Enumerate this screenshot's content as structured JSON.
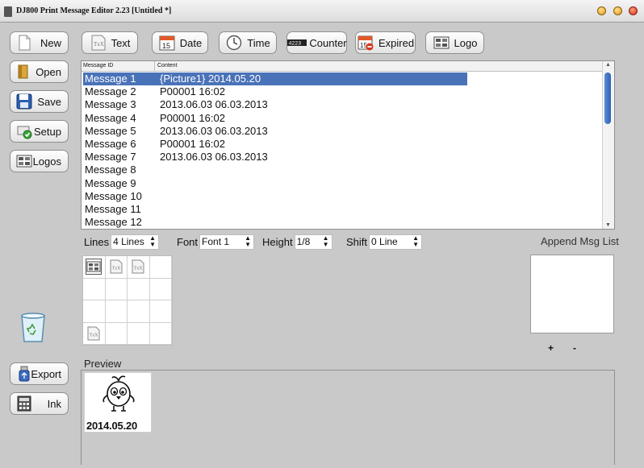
{
  "window": {
    "title": "DJ800 Print Message Editor 2.23 [Untitled *]"
  },
  "sidebar": [
    {
      "id": "new",
      "label": "New"
    },
    {
      "id": "open",
      "label": "Open"
    },
    {
      "id": "save",
      "label": "Save"
    },
    {
      "id": "setup",
      "label": "Setup"
    },
    {
      "id": "logos",
      "label": "Logos"
    }
  ],
  "sidebar_bottom": [
    {
      "id": "export",
      "label": "Export"
    },
    {
      "id": "ink",
      "label": "Ink"
    }
  ],
  "toolbar": [
    {
      "id": "text",
      "label": "Text",
      "icon": "text-icon"
    },
    {
      "id": "date",
      "label": "Date",
      "icon": "calendar-icon"
    },
    {
      "id": "time",
      "label": "Time",
      "icon": "clock-icon"
    },
    {
      "id": "counter",
      "label": "Counter",
      "icon": "counter-icon"
    },
    {
      "id": "expired",
      "label": "Expired",
      "icon": "expired-calendar-icon"
    },
    {
      "id": "logo",
      "label": "Logo",
      "icon": "logo-icon"
    }
  ],
  "message_list": {
    "columns": [
      "Message ID",
      "Content"
    ],
    "selected_index": 0,
    "rows": [
      {
        "id": "Message 1",
        "content": "{Picture1}  2014.05.20"
      },
      {
        "id": "Message 2",
        "content": "P00001  16:02"
      },
      {
        "id": "Message 3",
        "content": "2013.06.03  06.03.2013"
      },
      {
        "id": "Message 4",
        "content": "P00001  16:02"
      },
      {
        "id": "Message 5",
        "content": "2013.06.03  06.03.2013"
      },
      {
        "id": "Message 6",
        "content": "P00001  16:02"
      },
      {
        "id": "Message 7",
        "content": "2013.06.03  06.03.2013"
      },
      {
        "id": "Message 8",
        "content": ""
      },
      {
        "id": "Message 9",
        "content": ""
      },
      {
        "id": "Message 10",
        "content": ""
      },
      {
        "id": "Message 11",
        "content": ""
      },
      {
        "id": "Message 12",
        "content": ""
      }
    ]
  },
  "options": {
    "lines": {
      "label": "Lines",
      "value": "4 Lines"
    },
    "font": {
      "label": "Font",
      "value": "Font 1"
    },
    "height": {
      "label": "Height",
      "value": "1/8"
    },
    "shift": {
      "label": "Shift",
      "value": "0 Line"
    }
  },
  "append": {
    "label": "Append Msg List",
    "add": "+",
    "remove": "-"
  },
  "preview": {
    "label": "Preview",
    "text": "2014.05.20"
  },
  "colors": {
    "selection": "#4a72b8",
    "scroll_thumb": "#2e62b4",
    "background": "#c9c9c9"
  }
}
